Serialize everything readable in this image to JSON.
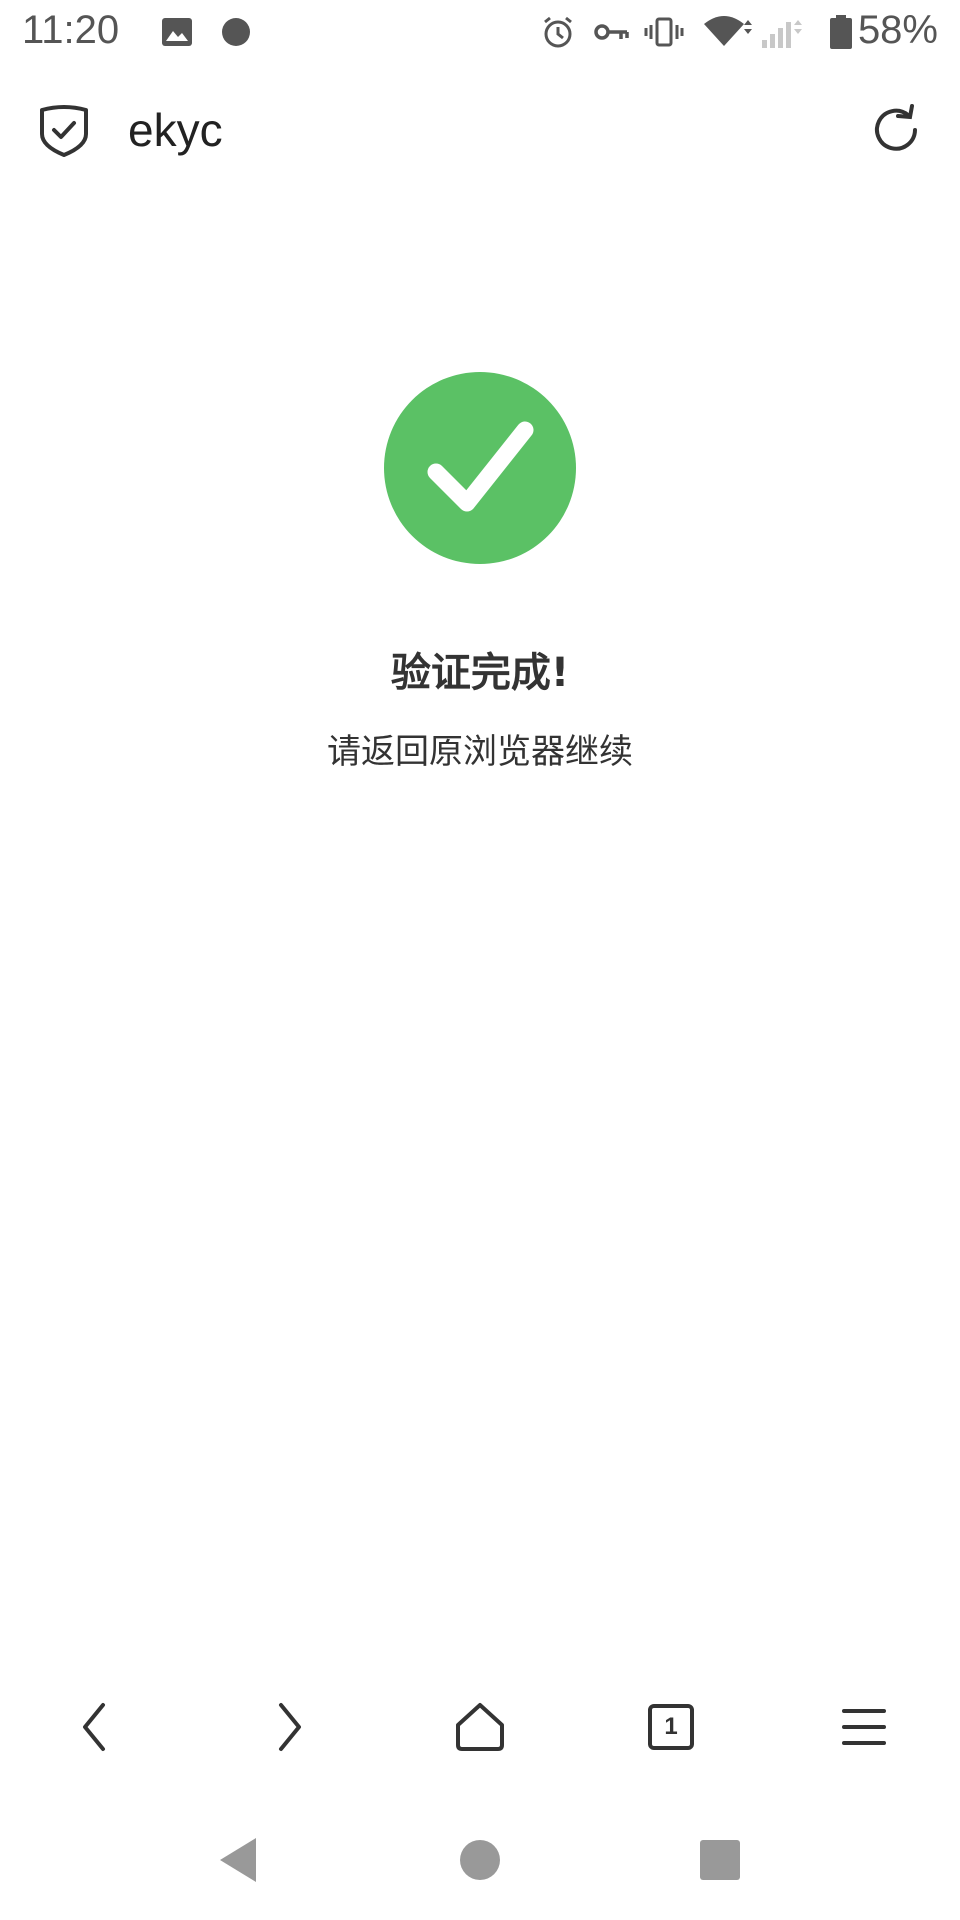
{
  "status_bar": {
    "time": "11:20",
    "battery_percent": "58%",
    "icons": [
      "image-icon",
      "record-dot-icon",
      "alarm-icon",
      "vpn-key-icon",
      "vibrate-icon",
      "wifi-icon",
      "signal-icon",
      "battery-icon"
    ]
  },
  "toolbar": {
    "title": "ekyc",
    "icons": [
      "shield-check-icon",
      "refresh-icon"
    ]
  },
  "main": {
    "success_title": "验证完成!",
    "success_subtitle": "请返回原浏览器继续",
    "accent_color": "#5bc165"
  },
  "browser_nav": {
    "tab_count": "1",
    "icons": [
      "back-icon",
      "forward-icon",
      "home-icon",
      "tabs-icon",
      "menu-icon"
    ]
  },
  "system_nav": {
    "icons": [
      "system-back-icon",
      "system-home-icon",
      "system-recents-icon"
    ]
  }
}
